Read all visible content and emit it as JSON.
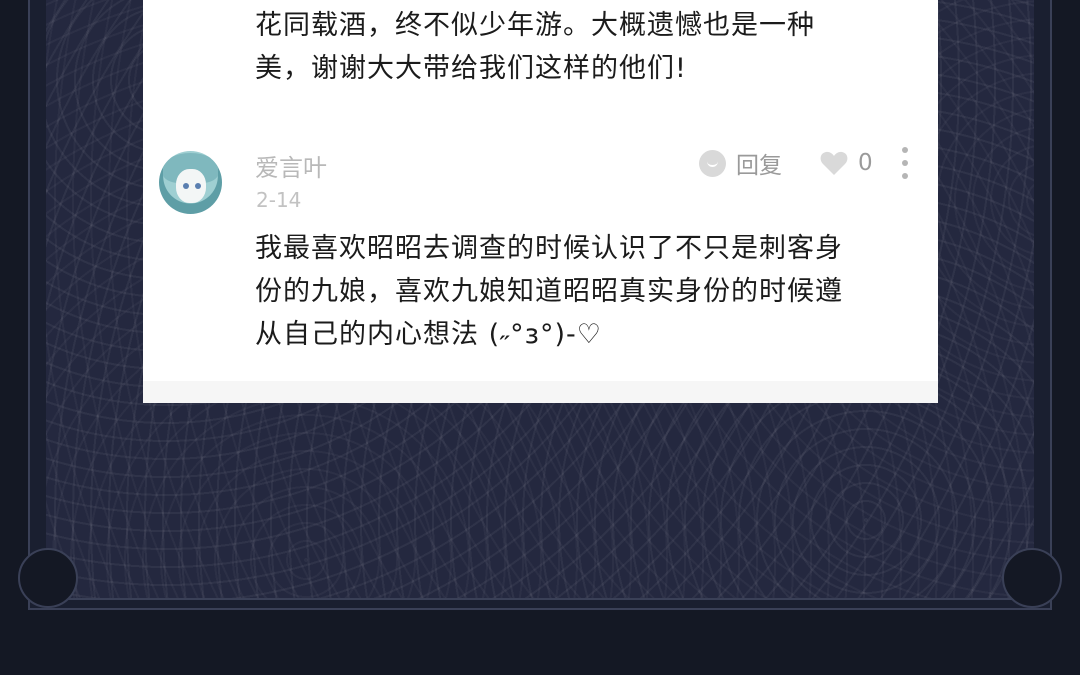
{
  "previous_comment": {
    "lines": [
      "花同载酒，终不似少年游。大概遗憾也是一种",
      "美，谢谢大大带给我们这样的他们!"
    ]
  },
  "comment": {
    "username": "爱言叶",
    "date": "2-14",
    "reply_label": "回复",
    "like_count": "0",
    "lines": [
      "我最喜欢昭昭去调查的时候认识了不只是刺客身",
      "份的九娘，喜欢九娘知道昭昭真实身份的时候遵",
      "从自己的内心想法 (˶°з°)-♡"
    ],
    "icons": {
      "reply": "reply-bubble-icon",
      "like": "heart-icon",
      "more": "more-vertical-icon"
    }
  },
  "colors": {
    "background": "#141824",
    "pattern": "#24283f",
    "card": "#ffffff",
    "muted_text": "#b8b8b8"
  }
}
